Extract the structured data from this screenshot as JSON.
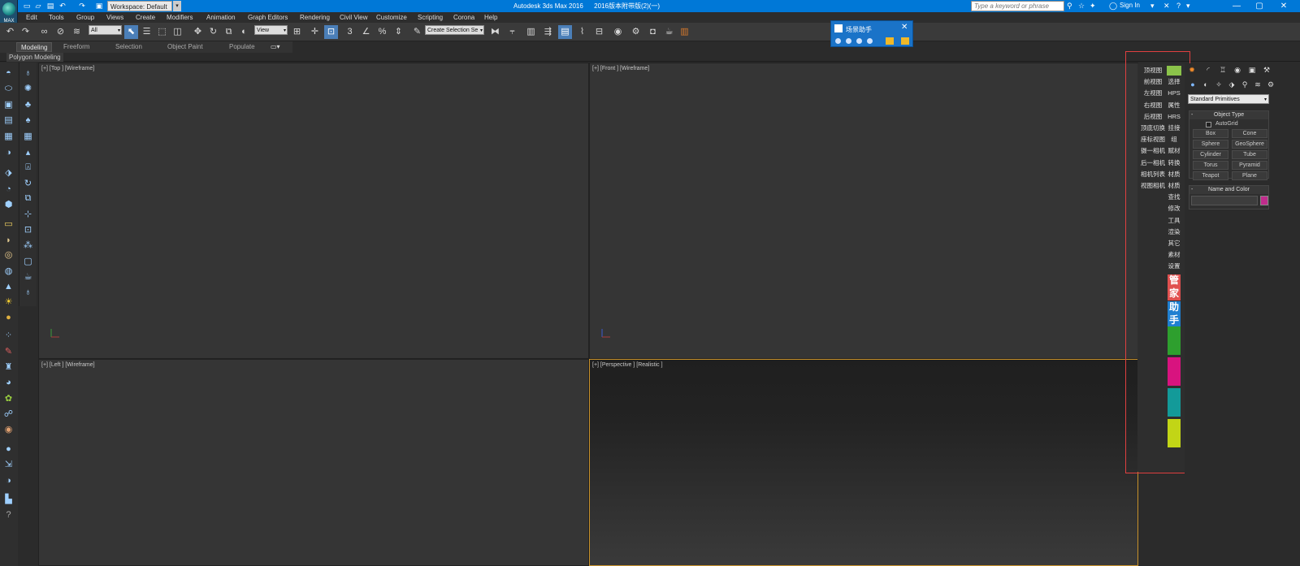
{
  "app": {
    "logo_text": "MAX",
    "title": "Autodesk 3ds Max 2016      2016版本附带版(2)(一)",
    "workspace": "Workspace: Default",
    "search_placeholder": "Type a keyword or phrase",
    "sign_in": "Sign In"
  },
  "menu": [
    "Edit",
    "Tools",
    "Group",
    "Views",
    "Create",
    "Modifiers",
    "Animation",
    "Graph Editors",
    "Rendering",
    "Civil View",
    "Customize",
    "Scripting",
    "Corona",
    "Help"
  ],
  "toolbar": {
    "filter": "All",
    "ref_coord": "View",
    "selection_set": "Create Selection Se",
    "snap_label": "3"
  },
  "ribbon": {
    "tabs": [
      "Modeling",
      "Freeform",
      "Selection",
      "Object Paint",
      "Populate"
    ],
    "active": "Modeling",
    "sub_label": "Polygon Modeling"
  },
  "viewports": {
    "top": "[+] [Top ] [Wireframe]",
    "front": "[+] [Front ] [Wireframe]",
    "left": "[+] [Left ] [Wireframe]",
    "persp": "[+] [Perspective ] [Realistic ]"
  },
  "scene_helper": {
    "title": "场景助手",
    "left": [
      "顶视图",
      "前视图",
      "左视图",
      "右视图",
      "后视图",
      "顶底切换",
      "座标视图",
      "摄一相机",
      "后一相机",
      "相机列表",
      "视图相机"
    ],
    "right": [
      "",
      "选择",
      "HPS",
      "属性",
      "HRS",
      "挂接",
      "组",
      "赋材",
      "转换",
      "材质",
      "材质",
      "查找",
      "修改",
      "工具",
      "渲染",
      "其它",
      "素材",
      "设置"
    ],
    "big": [
      "管",
      "家",
      "助",
      "手"
    ],
    "blocks": [
      "#2e9f2e",
      "#d8137f",
      "#139a99",
      "#c2d516"
    ]
  },
  "cmd_panel": {
    "primitive_type": "Standard Primitives",
    "object_type_title": "Object Type",
    "autogrid": "AutoGrid",
    "buttons": [
      "Box",
      "Cone",
      "Sphere",
      "GeoSphere",
      "Cylinder",
      "Tube",
      "Torus",
      "Pyramid",
      "Teapot",
      "Plane"
    ],
    "name_color_title": "Name and Color",
    "swatch_color": "#c02c8c"
  },
  "colors": {
    "accent": "#0078d7",
    "selection_frame": "#e04040",
    "active_viewport": "#c8912a"
  }
}
